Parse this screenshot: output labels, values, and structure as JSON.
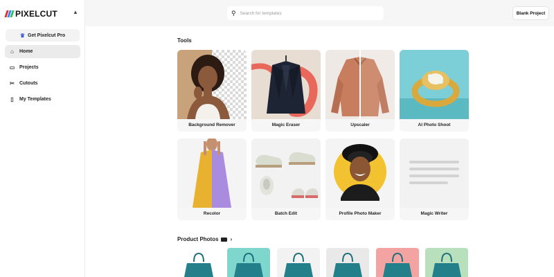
{
  "brand": {
    "name": "PIXELCUT",
    "colors": [
      "#e03131",
      "#3b82f6",
      "#22c55e"
    ]
  },
  "sidebar": {
    "pro_label": "Get Pixelcut Pro",
    "items": [
      {
        "label": "Home",
        "icon": "home-icon",
        "active": true
      },
      {
        "label": "Projects",
        "icon": "folder-icon",
        "active": false
      },
      {
        "label": "Cutouts",
        "icon": "scissors-icon",
        "active": false
      },
      {
        "label": "My Templates",
        "icon": "document-icon",
        "active": false
      }
    ]
  },
  "header": {
    "search_placeholder": "Search for templates",
    "blank_project_label": "Blank Project"
  },
  "tools": {
    "title": "Tools",
    "items": [
      {
        "label": "Background Remover"
      },
      {
        "label": "Magic Eraser"
      },
      {
        "label": "Upscaler"
      },
      {
        "label": "AI Photo Shoot"
      },
      {
        "label": "Recolor"
      },
      {
        "label": "Batch Edit"
      },
      {
        "label": "Profile Photo Maker"
      },
      {
        "label": "Magic Writer"
      }
    ]
  },
  "product_photos": {
    "title": "Product Photos",
    "backgrounds": [
      "#ffffff",
      "#7fd6cd",
      "#f2f2f2",
      "#e9e9e9",
      "#f4a3a3",
      "#b9e0bd"
    ]
  }
}
